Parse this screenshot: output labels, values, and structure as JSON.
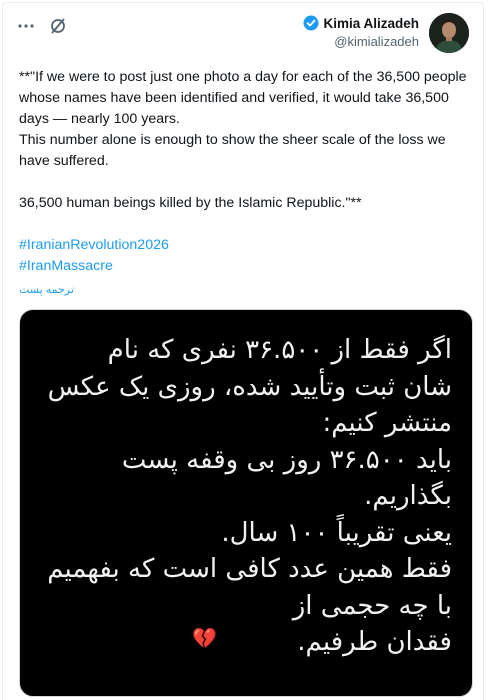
{
  "author": {
    "display_name": "Kimia Alizadeh",
    "handle": "@kimializadeh",
    "verified_color": "#1d9bf0"
  },
  "header_icons": [
    "more-icon",
    "grok-icon"
  ],
  "post": {
    "paragraphs": [
      "**\"If we were to post just one photo a day for each of the 36,500 people whose names have been identified and verified, it would take 36,500 days — nearly 100 years.",
      "This number alone is enough to show the sheer scale of the loss we have suffered."
    ],
    "closing": "36,500 human beings killed by the Islamic Republic.\"**",
    "hashtags": [
      "#IranianRevolution2026",
      "#IranMassacre"
    ],
    "translate_label": "ترجمه پست"
  },
  "media": {
    "lines": [
      "اگر فقط از ۳۶.۵۰۰ نفری که نام",
      "شان ثبت وتأیید شده، روزی یک عکس",
      "منتشر کنیم:",
      "باید ۳۶.۵۰۰ روز بی وقفه پست",
      "بگذاریم.",
      "یعنی تقریباً ۱۰۰ سال.",
      "فقط همین عدد کافی است که بفهمیم",
      "با چه حجمی از",
      "فقدان طرفیم."
    ],
    "emoji": "💔",
    "background": "#000000"
  }
}
